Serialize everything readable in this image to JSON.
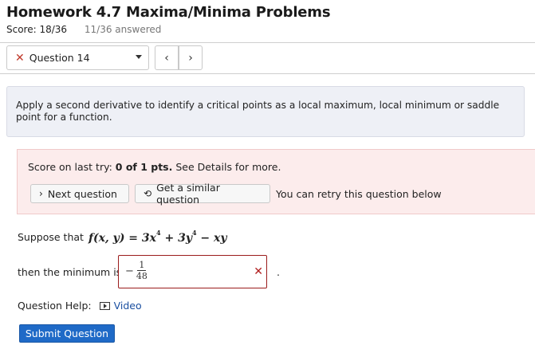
{
  "header": {
    "title": "Homework 4.7 Maxima/Minima Problems",
    "score": "Score: 18/36",
    "answered": "11/36 answered"
  },
  "nav": {
    "question_select": "Question 14",
    "status_icon": "x-icon",
    "prev_symbol": "‹",
    "next_symbol": "›"
  },
  "description": "Apply a second derivative to identify a critical points as a local maximum, local minimum or saddle point for a function.",
  "feedback": {
    "prefix": "Score on last try: ",
    "score_bold": "0 of 1 pts.",
    "suffix": " See Details for more.",
    "next_question": "Next question",
    "similar_question": "Get a similar question",
    "retry_text": "You can retry this question below",
    "background_color": "#fcecec"
  },
  "problem": {
    "suppose": "Suppose that",
    "function_lhs": "f(x, y) = 3x",
    "exp1": "4",
    "term2": " + 3y",
    "exp2": "4",
    "term3": " − xy",
    "min_label": "then the minimum is",
    "answer_sign": "−",
    "answer_numerator": "1",
    "answer_denominator": "48",
    "period": "."
  },
  "help": {
    "label": "Question Help:",
    "video": "Video"
  },
  "submit_label": "Submit Question",
  "colors": {
    "accent": "#1f6ac7",
    "error": "#b01e1e"
  }
}
